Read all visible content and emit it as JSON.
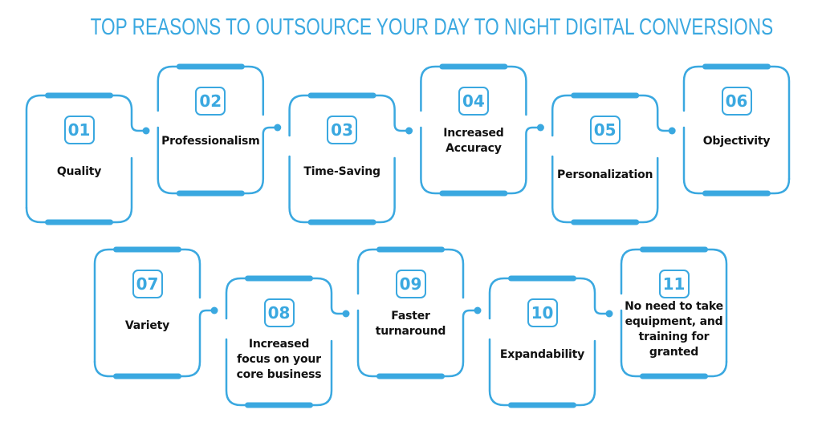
{
  "title": "TOP REASONS TO OUTSOURCE YOUR DAY TO NIGHT DIGITAL CONVERSIONS",
  "colors": {
    "accent": "#3aa8e0",
    "text": "#111111",
    "background": "#ffffff"
  },
  "rows": [
    {
      "cards": [
        {
          "number": "01",
          "label": "Quality"
        },
        {
          "number": "02",
          "label": "Professionalism"
        },
        {
          "number": "03",
          "label": "Time-Saving"
        },
        {
          "number": "04",
          "label": "Increased Accuracy"
        },
        {
          "number": "05",
          "label": "Personalization"
        },
        {
          "number": "06",
          "label": "Objectivity"
        }
      ]
    },
    {
      "cards": [
        {
          "number": "07",
          "label": "Variety"
        },
        {
          "number": "08",
          "label": "Increased focus on your core business"
        },
        {
          "number": "09",
          "label": "Faster turnaround"
        },
        {
          "number": "10",
          "label": "Expandability"
        },
        {
          "number": "11",
          "label": "No need to take equipment, and training for granted"
        }
      ]
    }
  ]
}
